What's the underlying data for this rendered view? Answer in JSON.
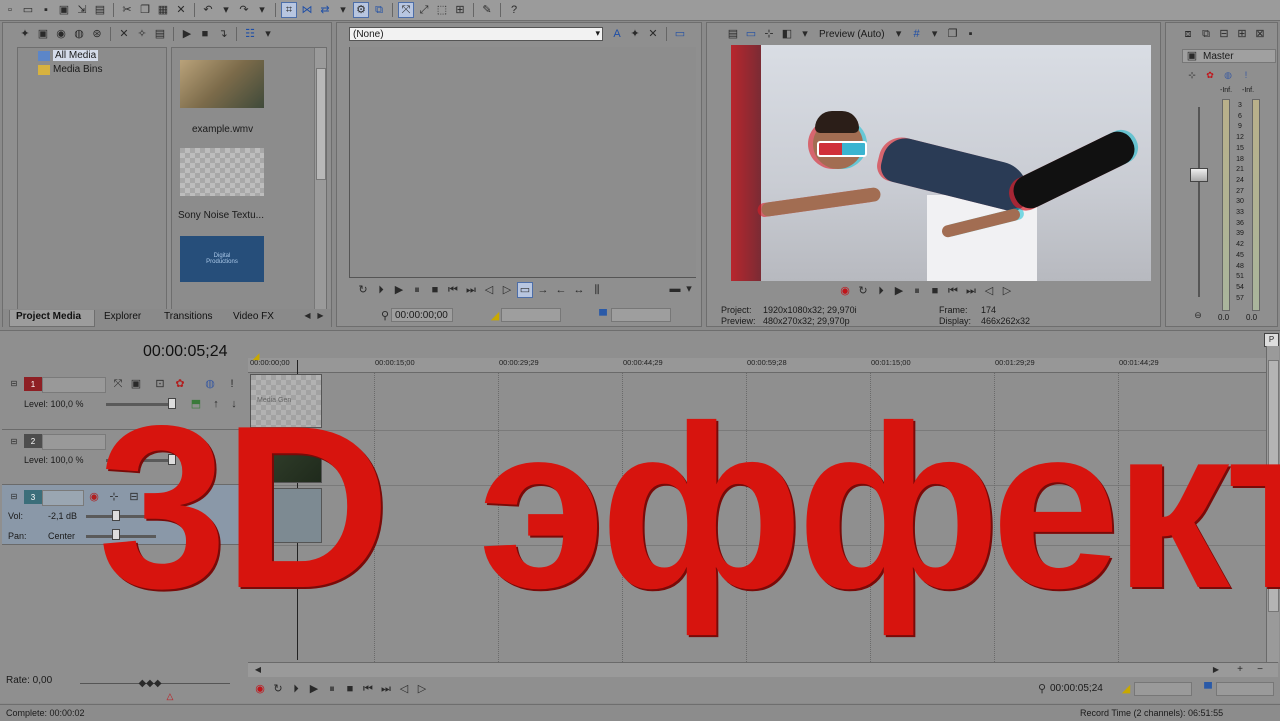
{
  "media": {
    "tree": [
      "All Media",
      "Media Bins"
    ],
    "items": [
      "example.wmv",
      "Sony Noise Textu..."
    ],
    "thumb_text": "Digital Productions"
  },
  "tabs": [
    "Project Media",
    "Explorer",
    "Transitions",
    "Video FX"
  ],
  "trimmer": {
    "dropdown": "(None)",
    "timecode": "00:00:00;00"
  },
  "preview": {
    "mode": "Preview (Auto)",
    "project_label": "Project:",
    "project_value": "1920x1080x32; 29,970i",
    "preview_label": "Preview:",
    "preview_value": "480x270x32; 29,970p",
    "frame_label": "Frame:",
    "frame_value": "174",
    "display_label": "Display:",
    "display_value": "466x262x32"
  },
  "mixer": {
    "title": "Master",
    "inf_left": "-Inf.",
    "inf_right": "-Inf.",
    "scale": [
      "3",
      "6",
      "9",
      "12",
      "15",
      "18",
      "21",
      "24",
      "27",
      "30",
      "33",
      "36",
      "39",
      "42",
      "45",
      "48",
      "51",
      "54",
      "57"
    ],
    "bottom_left": "0.0",
    "bottom_right": "0.0"
  },
  "timeline": {
    "cursor": "00:00:05;24",
    "ruler": [
      "00:00:00;00",
      "00:00:15;00",
      "00:00:29;29",
      "00:00:44;29",
      "00:00:59;28",
      "00:01:15;00",
      "00:01:29;29",
      "00:01:44;29"
    ],
    "tracks": [
      {
        "num": "1",
        "label": "Level: 100,0 %"
      },
      {
        "num": "2",
        "label": "Level: 100,0 %"
      },
      {
        "num": "3",
        "vol_label": "Vol:",
        "vol_value": "-2,1 dB",
        "pan_label": "Pan:",
        "pan_value": "Center"
      }
    ],
    "clip_text": "Media Gen"
  },
  "status": {
    "rate": "Rate: 0,00",
    "complete": "Complete: 00:00:02",
    "bottom_timecode": "00:00:05;24",
    "record_time": "Record Time (2 channels): 06:51:55"
  },
  "overlay": {
    "title_3d": "3D",
    "title_word": "эффект",
    "color": "#d7140e"
  }
}
